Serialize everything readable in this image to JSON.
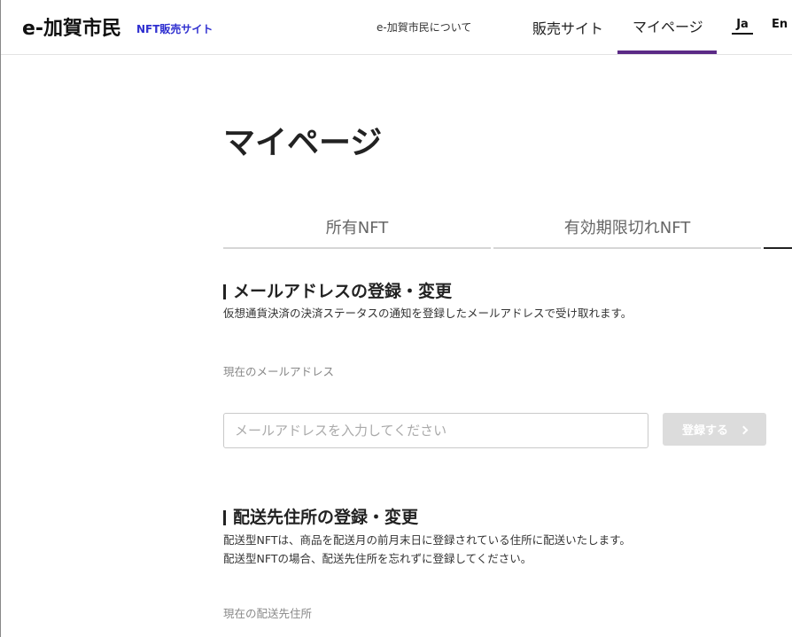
{
  "header": {
    "logo": "e-加賀市民",
    "logo_sub": "NFT販売サイト",
    "nav": {
      "about": "e-加賀市民について",
      "shop": "販売サイト",
      "mypage": "マイページ"
    },
    "lang": {
      "ja": "Ja",
      "en": "En"
    }
  },
  "main": {
    "title": "マイページ",
    "tabs": [
      {
        "label": "所有NFT"
      },
      {
        "label": "有効期限切れNFT"
      }
    ],
    "email_section": {
      "title": "メールアドレスの登録・変更",
      "description": "仮想通貨決済の決済ステータスの通知を登録したメールアドレスで受け取れます。",
      "current_label": "現在のメールアドレス",
      "input_value": "",
      "input_placeholder": "メールアドレスを入力してください",
      "button_label": "登録する"
    },
    "address_section": {
      "title": "配送先住所の登録・変更",
      "description_1": "配送型NFTは、商品を配送月の前月末日に登録されている住所に配送いたします。",
      "description_2": "配送型NFTの場合、配送先住所を忘れずに登録してください。",
      "current_label": "現在の配送先住所"
    }
  },
  "colors": {
    "accent": "#5b2a86",
    "logo_sub": "#2f2fd0",
    "button_disabled": "#dcdcdc"
  },
  "icons": [
    "chevron-right-icon"
  ]
}
